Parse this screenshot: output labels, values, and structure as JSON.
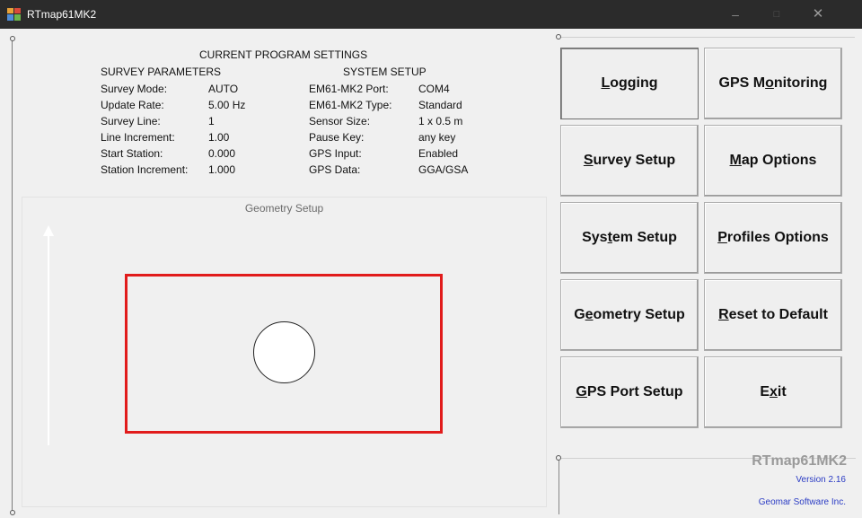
{
  "window": {
    "title": "RTmap61MK2",
    "minimize": "–",
    "maximize": "□",
    "close": "✕"
  },
  "settings": {
    "heading": "CURRENT PROGRAM SETTINGS",
    "survey": {
      "heading": "SURVEY PARAMETERS",
      "rows": [
        {
          "label": "Survey Mode:",
          "value": "AUTO"
        },
        {
          "label": "Update Rate:",
          "value": "5.00 Hz"
        },
        {
          "label": "Survey Line:",
          "value": "1"
        },
        {
          "label": "Line Increment:",
          "value": "1.00"
        },
        {
          "label": "Start Station:",
          "value": "0.000"
        },
        {
          "label": "Station Increment:",
          "value": "1.000"
        }
      ]
    },
    "system": {
      "heading": "SYSTEM SETUP",
      "rows": [
        {
          "label": "EM61-MK2 Port:",
          "value": "COM4"
        },
        {
          "label": "EM61-MK2 Type:",
          "value": "Standard"
        },
        {
          "label": "Sensor Size:",
          "value": "1 x 0.5 m"
        },
        {
          "label": "Pause Key:",
          "value": "any key"
        },
        {
          "label": "GPS Input:",
          "value": "Enabled"
        },
        {
          "label": "GPS Data:",
          "value": "GGA/GSA"
        }
      ]
    }
  },
  "geometry_panel": {
    "title": "Geometry Setup",
    "rect_color": "#e11b1b"
  },
  "buttons": {
    "logging": {
      "pre": "",
      "u": "L",
      "post": "ogging"
    },
    "gps_monitoring": {
      "pre": "GPS M",
      "u": "o",
      "post": "nitoring"
    },
    "survey_setup": {
      "pre": "",
      "u": "S",
      "post": "urvey Setup"
    },
    "map_options": {
      "pre": "",
      "u": "M",
      "post": "ap Options"
    },
    "system_setup": {
      "pre": "Sys",
      "u": "t",
      "post": "em Setup"
    },
    "profiles_options": {
      "pre": "",
      "u": "P",
      "post": "rofiles Options"
    },
    "geometry_setup": {
      "pre": "G",
      "u": "e",
      "post": "ometry Setup"
    },
    "reset_default": {
      "pre": "",
      "u": "R",
      "post": "eset to Default"
    },
    "gps_port_setup": {
      "pre": "",
      "u": "G",
      "post": "PS Port Setup"
    },
    "exit": {
      "pre": "E",
      "u": "x",
      "post": "it"
    }
  },
  "about": {
    "name": "RTmap61MK2",
    "version": "Version 2.16",
    "company": "Geomar Software Inc."
  },
  "colors": {
    "titlebar": "#2b2b2b",
    "link_blue": "#2b3cc4",
    "background": "#f0f0f0"
  }
}
